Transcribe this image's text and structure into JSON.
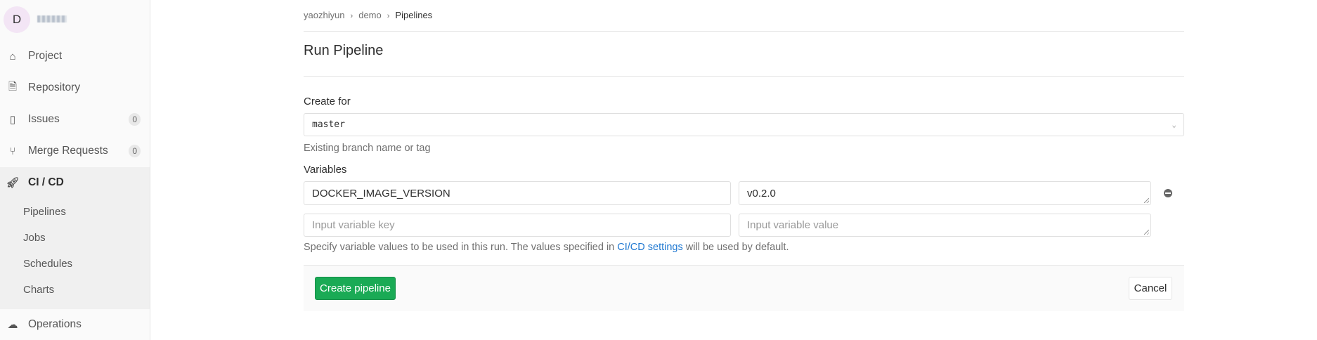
{
  "sidebar": {
    "avatar_letter": "D",
    "items": [
      {
        "label": "Project",
        "icon": "home-icon"
      },
      {
        "label": "Repository",
        "icon": "doc-icon"
      },
      {
        "label": "Issues",
        "icon": "issues-icon",
        "badge": "0"
      },
      {
        "label": "Merge Requests",
        "icon": "merge-request-icon",
        "badge": "0"
      },
      {
        "label": "CI / CD",
        "icon": "rocket-icon"
      },
      {
        "label": "Operations",
        "icon": "cloud-gear-icon"
      }
    ],
    "cicd_sub": [
      "Pipelines",
      "Jobs",
      "Schedules",
      "Charts"
    ]
  },
  "breadcrumb": [
    "yaozhiyun",
    "demo",
    "Pipelines"
  ],
  "title": "Run Pipeline",
  "form": {
    "create_for_label": "Create for",
    "branch_value": "master",
    "branch_help": "Existing branch name or tag",
    "variables_label": "Variables",
    "variables": [
      {
        "key": "DOCKER_IMAGE_VERSION",
        "value": "v0.2.0"
      }
    ],
    "key_placeholder": "Input variable key",
    "value_placeholder": "Input variable value",
    "help_before": "Specify variable values to be used in this run. The values specified in ",
    "help_link": "CI/CD settings",
    "help_after": " will be used by default."
  },
  "actions": {
    "create": "Create pipeline",
    "cancel": "Cancel"
  },
  "colors": {
    "primary": "#1aaa55",
    "link": "#1f78d1"
  }
}
